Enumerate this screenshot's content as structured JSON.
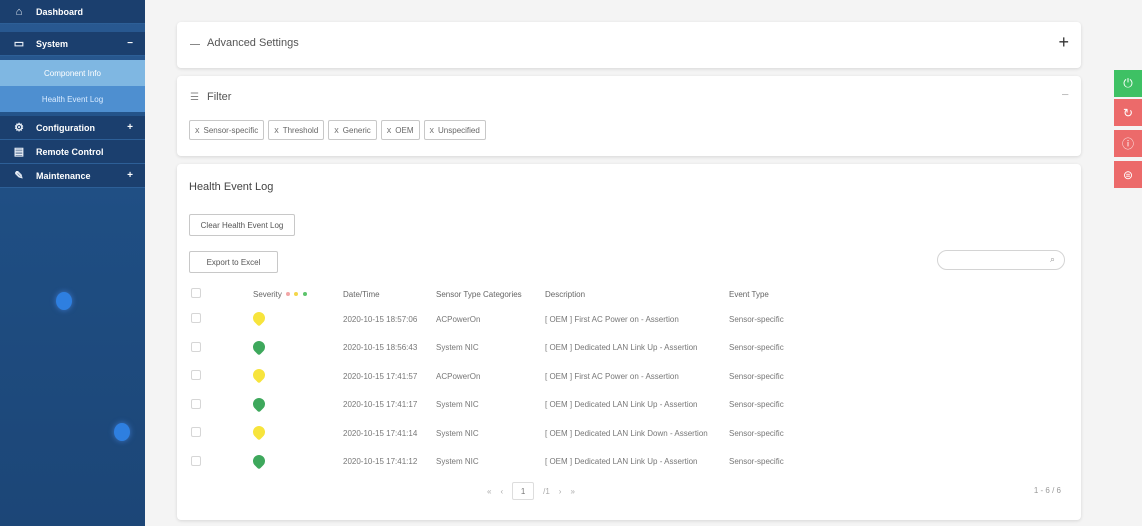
{
  "sidebar": {
    "items": [
      {
        "label": "Dashboard",
        "icon": "dashboard-icon",
        "glyph": "⌂",
        "trail": ""
      },
      {
        "label": "System",
        "icon": "monitor-icon",
        "glyph": "▭",
        "trail": "−"
      },
      {
        "label": "Configuration",
        "icon": "gear-icon",
        "glyph": "⚙",
        "trail": "+"
      },
      {
        "label": "Remote Control",
        "icon": "remote-icon",
        "glyph": "▤",
        "trail": ""
      },
      {
        "label": "Maintenance",
        "icon": "wrench-icon",
        "glyph": "✎",
        "trail": "+"
      }
    ],
    "subitems": [
      "Component Info",
      "Health Event Log"
    ]
  },
  "advanced": {
    "title": "Advanced Settings",
    "toggle": "+"
  },
  "filter": {
    "title": "Filter",
    "icon_glyph": "☰",
    "collapse": "−",
    "tags": [
      "Sensor-specific",
      "Threshold",
      "Generic",
      "OEM",
      "Unspecified"
    ],
    "tag_close": "x"
  },
  "log": {
    "title": "Health Event Log",
    "clear_label": "Clear Health Event Log",
    "export_label": "Export to Excel",
    "search_icon_glyph": "⌕",
    "columns": [
      "Severity",
      "Date/Time",
      "Sensor Type Categories",
      "Description",
      "Event Type"
    ],
    "severity_dots": [
      "#f2a6a6",
      "#f3d64a",
      "#5cc46b"
    ],
    "rows": [
      {
        "severity": "yellow",
        "datetime": "2020-10-15 18:57:06",
        "sensor": "ACPowerOn",
        "description": "[ OEM ] First AC Power on - Assertion",
        "event_type": "Sensor-specific"
      },
      {
        "severity": "green",
        "datetime": "2020-10-15 18:56:43",
        "sensor": "System NIC",
        "description": "[ OEM ] Dedicated LAN Link Up - Assertion",
        "event_type": "Sensor-specific"
      },
      {
        "severity": "yellow",
        "datetime": "2020-10-15 17:41:57",
        "sensor": "ACPowerOn",
        "description": "[ OEM ] First AC Power on - Assertion",
        "event_type": "Sensor-specific"
      },
      {
        "severity": "green",
        "datetime": "2020-10-15 17:41:17",
        "sensor": "System NIC",
        "description": "[ OEM ] Dedicated LAN Link Up - Assertion",
        "event_type": "Sensor-specific"
      },
      {
        "severity": "yellow",
        "datetime": "2020-10-15 17:41:14",
        "sensor": "System NIC",
        "description": "[ OEM ] Dedicated LAN Link Down - Assertion",
        "event_type": "Sensor-specific"
      },
      {
        "severity": "green",
        "datetime": "2020-10-15 17:41:12",
        "sensor": "System NIC",
        "description": "[ OEM ] Dedicated LAN Link Up - Assertion",
        "event_type": "Sensor-specific"
      }
    ],
    "pager": {
      "first": "«",
      "prev": "‹",
      "page": "1",
      "total": "/1",
      "next": "›",
      "last": "»"
    },
    "range": "1 - 6 / 6"
  },
  "floating_buttons": [
    {
      "name": "power-icon",
      "glyph": "⏻"
    },
    {
      "name": "refresh-icon",
      "glyph": "↻"
    },
    {
      "name": "info-icon",
      "glyph": "ⓘ"
    },
    {
      "name": "globe-icon",
      "glyph": "⊜"
    }
  ]
}
